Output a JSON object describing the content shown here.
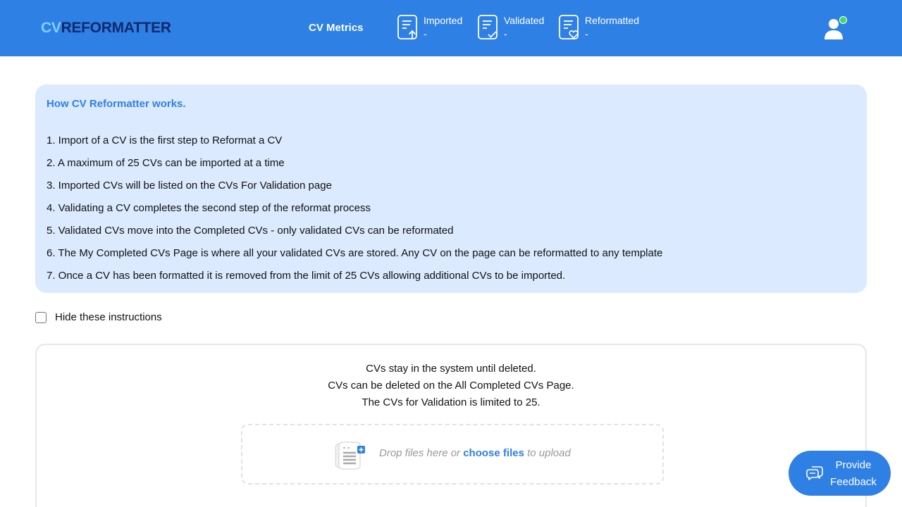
{
  "header": {
    "logo_cv": "CV",
    "logo_rest": "REFORMATTER",
    "metrics_title": "CV Metrics",
    "metrics": [
      {
        "label": "Imported",
        "value": "-",
        "icon": "document-upload-icon"
      },
      {
        "label": "Validated",
        "value": "-",
        "icon": "document-check-icon"
      },
      {
        "label": "Reformatted",
        "value": "-",
        "icon": "document-heart-icon"
      }
    ],
    "user_icon": "user-icon",
    "status_color": "#3ddc5a"
  },
  "instructions": {
    "title": "How CV Reformatter works.",
    "steps": [
      "1. Import of a CV is the first step to Reformat a CV",
      "2. A maximum of 25 CVs can be imported at a time",
      "3. Imported CVs will be listed on the CVs For Validation page",
      "4. Validating a CV completes the second step of the reformat process",
      "5. Validated CVs move into the Completed CVs - only validated CVs can be reformated",
      "6. The My Completed CVs Page is where all your validated CVs are stored. Any CV on the page can be reformatted to any template",
      "7. Once a CV has been formatted it is removed from the limit of 25 CVs allowing additional CVs to be imported."
    ],
    "hide_label": "Hide these instructions",
    "hide_checked": false
  },
  "upload": {
    "notes": [
      "CVs stay in the system until deleted.",
      "CVs can be deleted on the All Completed CVs Page.",
      "The CVs for Validation is limited to 25."
    ],
    "drop_prefix": "Drop files here or ",
    "choose_label": "choose files",
    "drop_suffix": " to upload"
  },
  "feedback": {
    "line1": "Provide",
    "line2": "Feedback"
  },
  "colors": {
    "brand": "#2f80e4",
    "panel": "#dbeafe"
  }
}
